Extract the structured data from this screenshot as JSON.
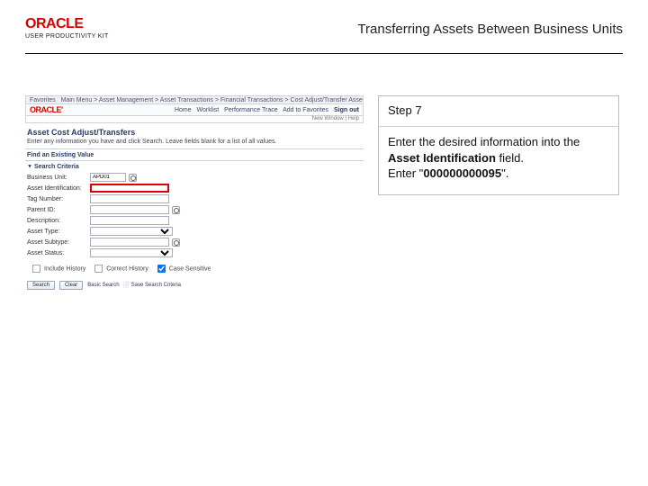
{
  "header": {
    "logo_text": "ORACLE",
    "logo_subtext": "USER PRODUCTIVITY KIT",
    "title": "Transferring Assets Between Business Units"
  },
  "panel": {
    "step": "Step 7",
    "line1": "Enter the desired information into the ",
    "field_name": "Asset Identification",
    "line1_suffix": " field.",
    "line2_prefix": "Enter \"",
    "value": "000000000095",
    "line2_suffix": "\"."
  },
  "shot": {
    "crumb_items": [
      "Favorites",
      "Main Menu",
      "Asset Management",
      "Asset Transactions",
      "Financial Transactions",
      "Cost Adjust/Transfer Asset"
    ],
    "brand": "ORACLE'",
    "toplinks": [
      "Home",
      "Worklist",
      "Performance Trace",
      "Add to Favorites"
    ],
    "signout": "Sign out",
    "subbar": "New Window | Help",
    "page_title": "Asset Cost Adjust/Transfers",
    "description": "Enter any information you have and click Search. Leave fields blank for a list of all values.",
    "section1": "Find an Existing Value",
    "section2": "Search Criteria",
    "fields": {
      "business_unit": {
        "label": "Business Unit:",
        "value": "APD01"
      },
      "asset_id": {
        "label": "Asset Identification:",
        "value": ""
      },
      "tag_number": {
        "label": "Tag Number:",
        "value": ""
      },
      "parent_id": {
        "label": "Parent ID:",
        "value": ""
      },
      "description": {
        "label": "Description:",
        "value": ""
      },
      "asset_type": {
        "label": "Asset Type:",
        "selected": ""
      },
      "asset_subtype": {
        "label": "Asset Subtype:",
        "value": ""
      },
      "asset_status": {
        "label": "Asset Status:",
        "selected": ""
      }
    },
    "checkboxes": {
      "include_history": "Include History",
      "correct_history": "Correct History",
      "case_sensitive": "Case Sensitive"
    },
    "buttons": {
      "search": "Search",
      "clear": "Clear",
      "basic": "Basic Search",
      "save": "Save Search Criteria"
    }
  }
}
